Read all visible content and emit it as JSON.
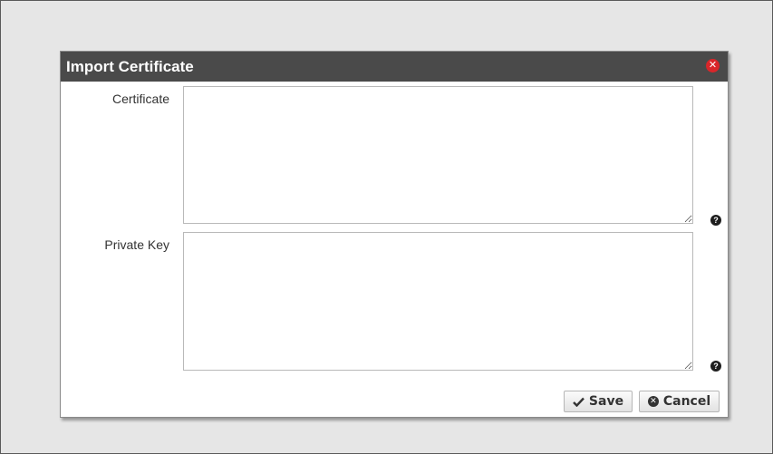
{
  "dialog": {
    "title": "Import Certificate",
    "close_icon": "close-circle-icon"
  },
  "fields": {
    "certificate": {
      "label": "Certificate",
      "value": "",
      "help_icon": "question-circle-icon"
    },
    "private_key": {
      "label": "Private Key",
      "value": "",
      "help_icon": "question-circle-icon"
    }
  },
  "buttons": {
    "save": {
      "label": "Save",
      "icon": "checkmark-icon"
    },
    "cancel": {
      "label": "Cancel",
      "icon": "cancel-circle-icon"
    }
  },
  "colors": {
    "titlebar": "#4a4a4a",
    "close": "#d9262a",
    "backdrop": "#e6e6e6"
  }
}
